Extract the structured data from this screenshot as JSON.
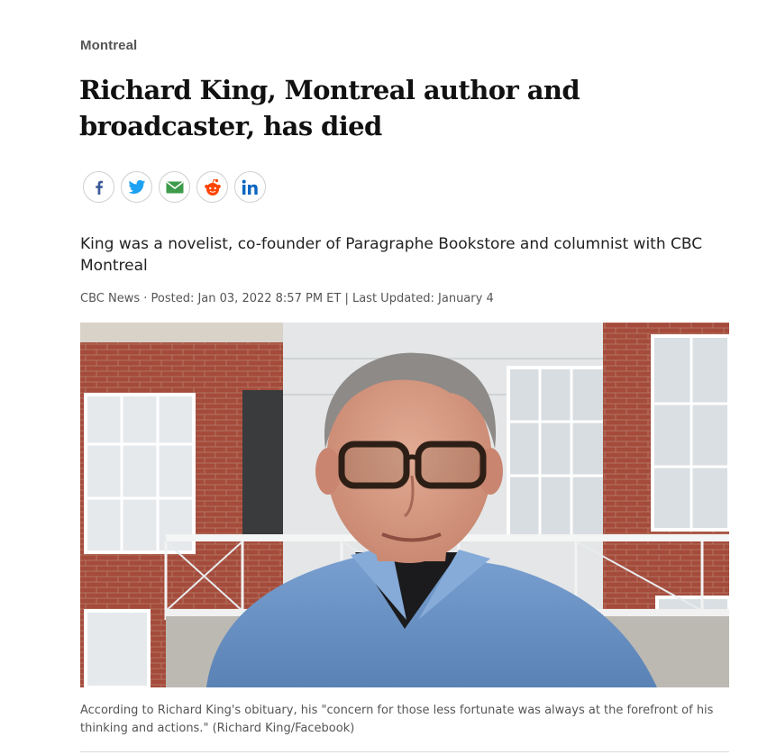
{
  "section": {
    "label": "Montreal"
  },
  "article": {
    "headline": "Richard King, Montreal author and broadcaster, has died",
    "deck": "King was a novelist, co-founder of Paragraphe Bookstore and columnist with CBC Montreal",
    "byline": "CBC News · Posted: Jan 03, 2022 8:57 PM ET | Last Updated: January 4"
  },
  "share": {
    "buttons": [
      {
        "icon": "facebook-icon",
        "color": "#3b5998"
      },
      {
        "icon": "twitter-icon",
        "color": "#1da1f2"
      },
      {
        "icon": "email-icon",
        "color": "#2e8b3d"
      },
      {
        "icon": "reddit-icon",
        "color": "#ff4500"
      },
      {
        "icon": "linkedin-icon",
        "color": "#0a66c2"
      }
    ]
  },
  "photo": {
    "caption": "According to Richard King's obituary, his \"concern for those less fortunate was always at the forefront of his thinking and actions.\" (Richard King/Facebook)"
  },
  "colors": {
    "text": "#111111",
    "muted": "#555555",
    "brick": "#a44a3a",
    "shirt": "#6d94c5"
  }
}
